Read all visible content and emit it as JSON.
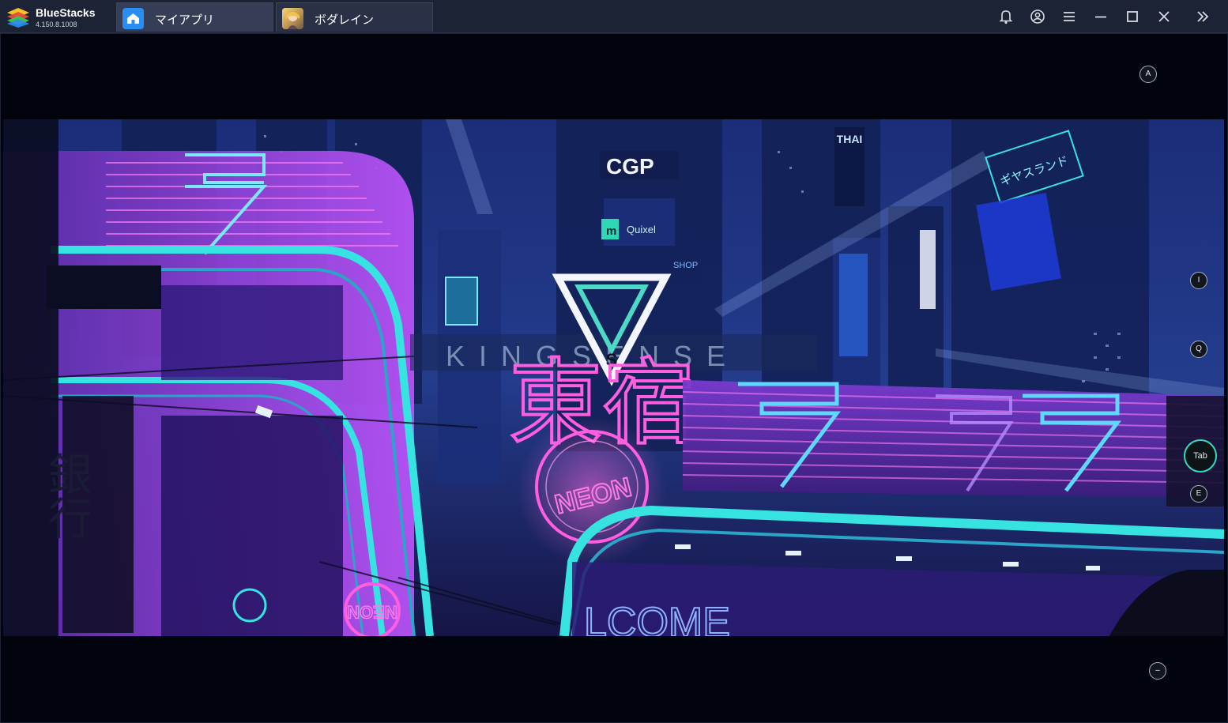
{
  "app": {
    "name": "BlueStacks",
    "version": "4.150.8.1008"
  },
  "tabs": [
    {
      "label": "マイアプリ",
      "icon": "home-icon",
      "active": true
    },
    {
      "label": "ボダレイン",
      "icon": "game-avatar-icon",
      "active": false
    }
  ],
  "window_controls": [
    {
      "name": "notifications",
      "icon": "bell-icon"
    },
    {
      "name": "account",
      "icon": "account-icon"
    },
    {
      "name": "menu",
      "icon": "hamburger-menu-icon"
    },
    {
      "name": "minimize",
      "icon": "minimize-icon"
    },
    {
      "name": "maximize",
      "icon": "maximize-icon"
    },
    {
      "name": "close",
      "icon": "close-icon"
    },
    {
      "name": "sidebar-toggle",
      "icon": "double-chevron-right-icon"
    }
  ],
  "key_hints": {
    "a": "A",
    "i": "I",
    "q": "Q",
    "tab": "Tab",
    "e": "E",
    "minus": "–"
  },
  "scene_text": {
    "cgp": "CGP",
    "quixel": "Quixel",
    "shop": "SHOP",
    "logo_letter": "S",
    "logo_word": "KINGSENSE",
    "neon": "NEON",
    "welcome": "LCOME",
    "kanji_tokyo": "東宿",
    "kanji_bank": "銀行",
    "thai": "THAI",
    "kata_sign": "ギヤスランド"
  },
  "colors": {
    "titlebar": "#1c2334",
    "tab_bg": "#2a3146",
    "home_icon_bg": "#2a8df2",
    "neon_cyan": "#37e3e0",
    "neon_pink": "#ff4fd8",
    "neon_purple": "#b84cff"
  }
}
